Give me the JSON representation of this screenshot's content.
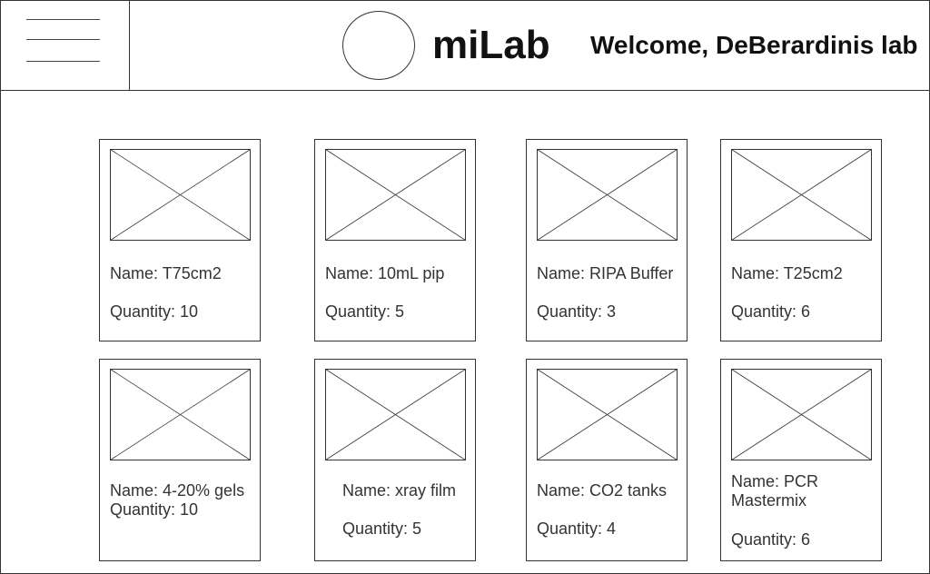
{
  "header": {
    "app_title": "miLab",
    "welcome_text": "Welcome, DeBerardinis lab"
  },
  "items": [
    {
      "name": "Name: T75cm2",
      "quantity": "Quantity: 10"
    },
    {
      "name": "Name: 10mL pip",
      "quantity": "Quantity: 5"
    },
    {
      "name": "Name: RIPA Buffer",
      "quantity": "Quantity: 3"
    },
    {
      "name": "Name: T25cm2",
      "quantity": "Quantity: 6"
    },
    {
      "name": "Name: 4-20% gels",
      "quantity": "Quantity: 10"
    },
    {
      "name": "Name: xray film",
      "quantity": "Quantity: 5"
    },
    {
      "name": "Name: CO2 tanks",
      "quantity": "Quantity: 4"
    },
    {
      "name": "Name: PCR Mastermix",
      "quantity": "Quantity: 6"
    }
  ]
}
